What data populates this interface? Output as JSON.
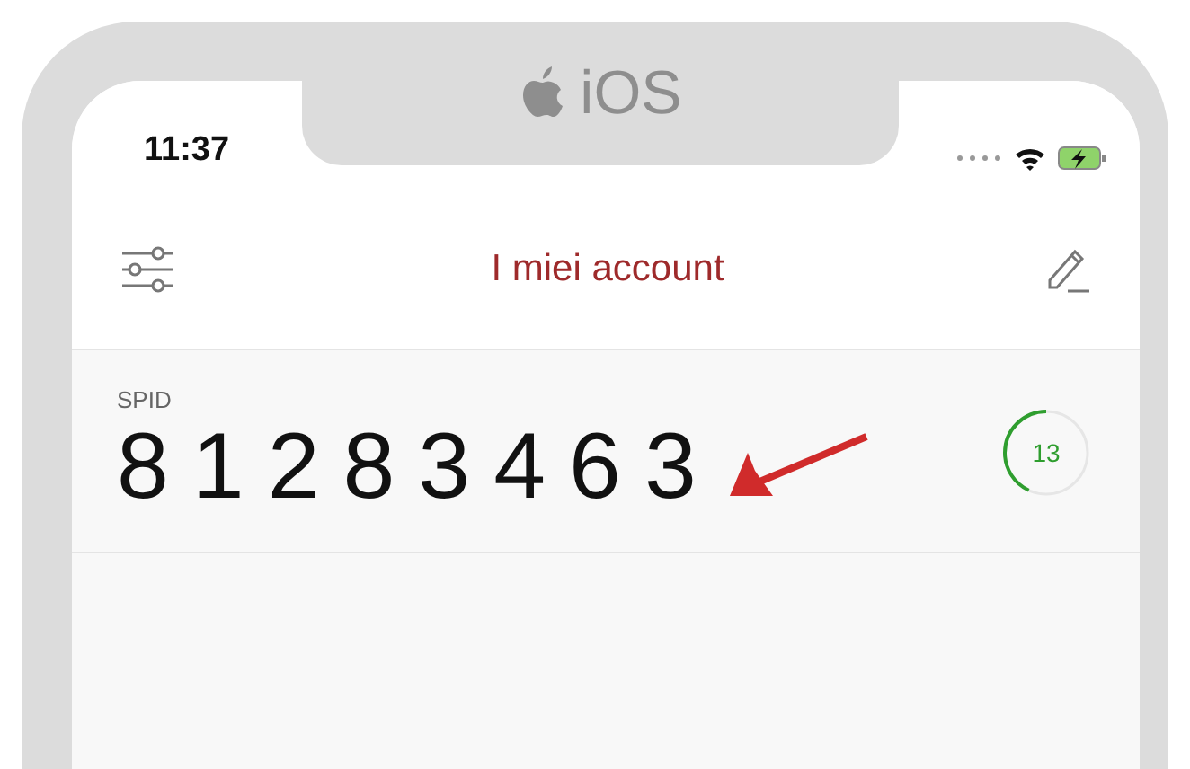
{
  "notch": {
    "label": "iOS"
  },
  "status_bar": {
    "time": "11:37"
  },
  "header": {
    "title": "I miei account"
  },
  "accounts": [
    {
      "name": "SPID",
      "code": "81283463",
      "timer": {
        "reading": "13",
        "level": 0.43
      }
    }
  ]
}
